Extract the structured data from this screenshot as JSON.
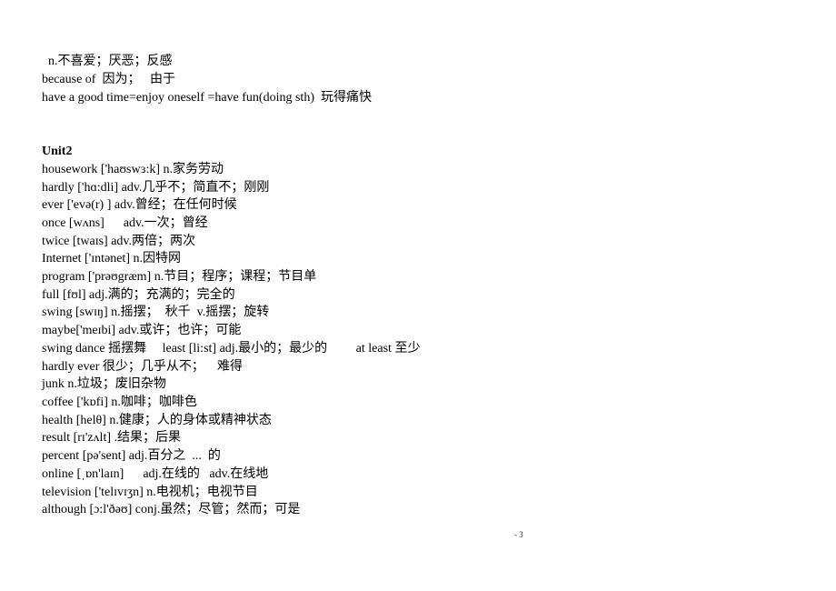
{
  "page": {
    "pre_lines": [
      "n.不喜爱；厌恶；反感",
      "because of  因为；   由于",
      "have a good time=enjoy oneself =have fun(doing sth)  玩得痛快"
    ],
    "unit_heading": "Unit2",
    "vocab_lines": [
      "housework ['haʊswɜ:k] n.家务劳动",
      "hardly ['hɑ:dli] adv.几乎不；简直不；刚刚",
      "ever ['evə(r) ] adv.曾经；在任何时候",
      "once [wʌns]      adv.一次；曾经",
      "twice [twaɪs] adv.两倍；两次",
      "Internet ['ɪntənet] n.因特网",
      "program ['prəʊgræm] n.节目；程序；课程；节目单",
      "full [fʊl] adj.满的；充满的；完全的",
      "swing [swɪŋ] n.摇摆；  秋千  v.摇摆；旋转",
      "maybe['meɪbi] adv.或许；也许；可能",
      "swing dance 摇摆舞     least [li:st] adj.最小的；最少的         at least 至少",
      "hardly ever 很少；几乎从不；    难得",
      "junk n.垃圾；废旧杂物",
      "coffee ['kɒfi] n.咖啡；咖啡色",
      "health [helθ] n.健康；人的身体或精神状态",
      "result [rɪ'zʌlt] .结果；后果",
      "percent [pə'sent] adj.百分之  ...  的",
      "online [ˌɒn'laɪn]      adj.在线的   adv.在线地",
      "television ['telɪvɪʒn] n.电视机；电视节目",
      "although [ɔ:l'ðəʊ] conj.虽然；尽管；然而；可是"
    ],
    "page_number": "- 3"
  }
}
